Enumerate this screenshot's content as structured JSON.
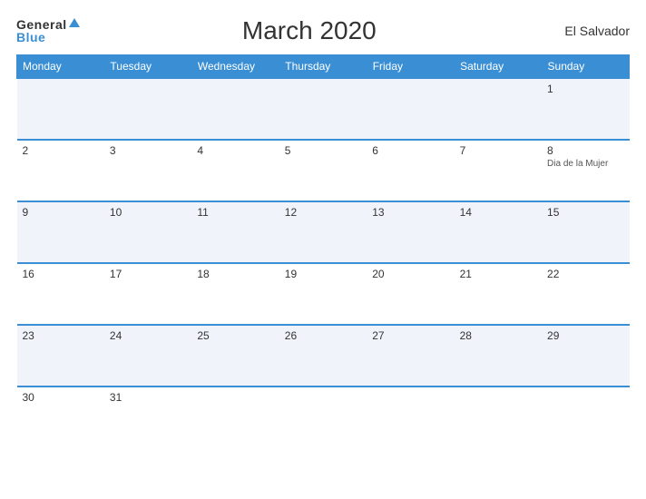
{
  "header": {
    "logo_general": "General",
    "logo_blue": "Blue",
    "title": "March 2020",
    "country": "El Salvador"
  },
  "days_of_week": [
    "Monday",
    "Tuesday",
    "Wednesday",
    "Thursday",
    "Friday",
    "Saturday",
    "Sunday"
  ],
  "weeks": [
    [
      {
        "day": "",
        "event": ""
      },
      {
        "day": "",
        "event": ""
      },
      {
        "day": "",
        "event": ""
      },
      {
        "day": "",
        "event": ""
      },
      {
        "day": "",
        "event": ""
      },
      {
        "day": "",
        "event": ""
      },
      {
        "day": "1",
        "event": ""
      }
    ],
    [
      {
        "day": "2",
        "event": ""
      },
      {
        "day": "3",
        "event": ""
      },
      {
        "day": "4",
        "event": ""
      },
      {
        "day": "5",
        "event": ""
      },
      {
        "day": "6",
        "event": ""
      },
      {
        "day": "7",
        "event": ""
      },
      {
        "day": "8",
        "event": "Dia de la Mujer"
      }
    ],
    [
      {
        "day": "9",
        "event": ""
      },
      {
        "day": "10",
        "event": ""
      },
      {
        "day": "11",
        "event": ""
      },
      {
        "day": "12",
        "event": ""
      },
      {
        "day": "13",
        "event": ""
      },
      {
        "day": "14",
        "event": ""
      },
      {
        "day": "15",
        "event": ""
      }
    ],
    [
      {
        "day": "16",
        "event": ""
      },
      {
        "day": "17",
        "event": ""
      },
      {
        "day": "18",
        "event": ""
      },
      {
        "day": "19",
        "event": ""
      },
      {
        "day": "20",
        "event": ""
      },
      {
        "day": "21",
        "event": ""
      },
      {
        "day": "22",
        "event": ""
      }
    ],
    [
      {
        "day": "23",
        "event": ""
      },
      {
        "day": "24",
        "event": ""
      },
      {
        "day": "25",
        "event": ""
      },
      {
        "day": "26",
        "event": ""
      },
      {
        "day": "27",
        "event": ""
      },
      {
        "day": "28",
        "event": ""
      },
      {
        "day": "29",
        "event": ""
      }
    ],
    [
      {
        "day": "30",
        "event": ""
      },
      {
        "day": "31",
        "event": ""
      },
      {
        "day": "",
        "event": ""
      },
      {
        "day": "",
        "event": ""
      },
      {
        "day": "",
        "event": ""
      },
      {
        "day": "",
        "event": ""
      },
      {
        "day": "",
        "event": ""
      }
    ]
  ],
  "colors": {
    "header_bg": "#3a8fd4",
    "accent": "#3a8fd4",
    "odd_row": "#f0f4fa",
    "even_row": "#ffffff"
  }
}
